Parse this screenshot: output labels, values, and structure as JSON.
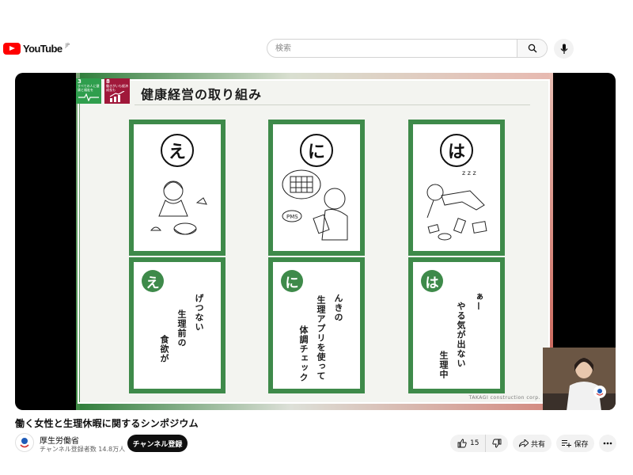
{
  "header": {
    "logo_text": "YouTube",
    "logo_region": "JP",
    "search_placeholder": "検索"
  },
  "slide": {
    "title": "健康経営の取り組み",
    "sdg_badges": [
      {
        "number": "3",
        "label": "すべての人に健康と福祉を",
        "color": "#2f9e4d"
      },
      {
        "number": "8",
        "label": "働きがいも経済成長も",
        "color": "#a0183a"
      }
    ],
    "cards": [
      {
        "kana": "え",
        "lines": [
          "げつない",
          "生理前の",
          "食欲が"
        ]
      },
      {
        "kana": "に",
        "lines": [
          "んきの",
          "生理アプリを使って",
          "体調チェック"
        ]
      },
      {
        "kana": "は",
        "lines": [
          "ぁー",
          "やる気が出ない",
          "生理中"
        ]
      }
    ],
    "credit": "TAKAGI construction corp.",
    "accent_color": "#3e8a4a"
  },
  "video": {
    "title": "働く女性と生理休暇に関するシンポジウム",
    "channel_name": "厚生労働省",
    "subscribers": "チャンネル登録者数 14.8万人",
    "subscribe_label": "チャンネル登録",
    "like_count": "15",
    "share_label": "共有",
    "save_label": "保存"
  }
}
